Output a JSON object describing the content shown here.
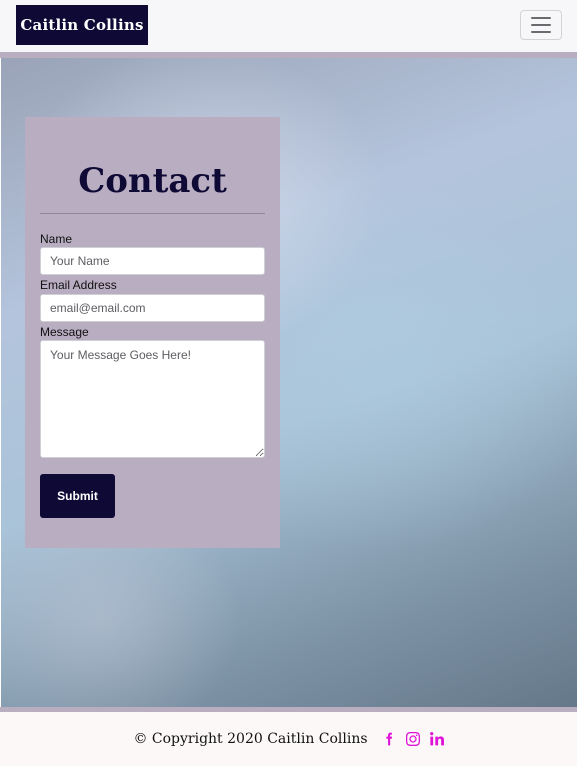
{
  "navbar": {
    "brand": "Caitlin Collins",
    "toggler_icon": "hamburger-menu-icon"
  },
  "contact": {
    "title": "Contact",
    "name_label": "Name",
    "name_placeholder": "Your Name",
    "email_label": "Email Address",
    "email_placeholder": "email@email.com",
    "message_label": "Message",
    "message_placeholder": "Your Message Goes Here!",
    "submit_label": "Submit"
  },
  "footer": {
    "copyright": "© Copyright 2020 Caitlin Collins",
    "social_icons": [
      "facebook-icon",
      "instagram-icon",
      "linkedin-icon"
    ]
  },
  "colors": {
    "brand_navy": "#0f0a35",
    "card_mauve": "#b8adc1",
    "accent_magenta": "#e014d8"
  }
}
